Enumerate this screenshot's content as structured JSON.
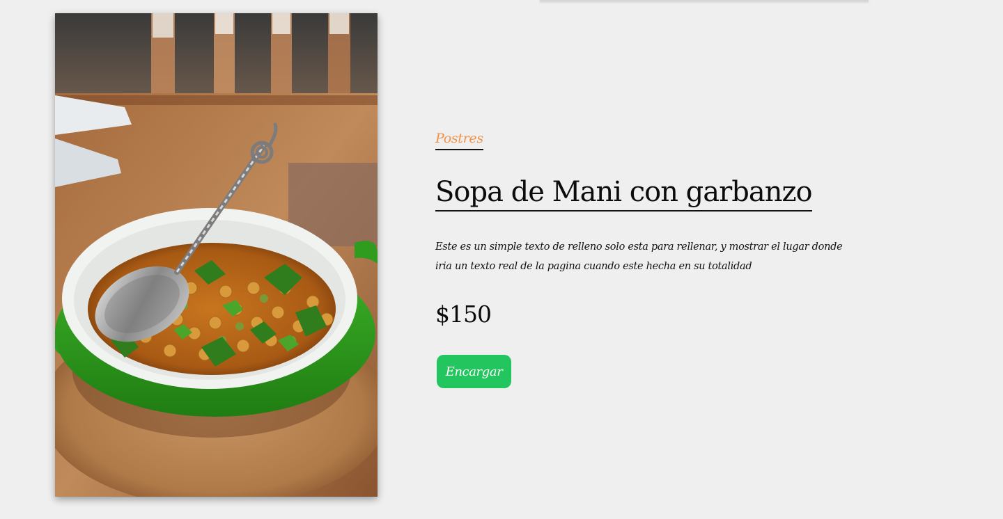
{
  "product": {
    "category": "Postres",
    "title": "Sopa de Mani con garbanzo",
    "description": "Este es un simple texto de relleno solo esta para rellenar, y mostrar el lugar donde iria un texto real de la pagina cuando este hecha en su totalidad",
    "price": "$150",
    "order_label": "Encargar"
  },
  "colors": {
    "background": "#efefef",
    "category": "#f0934a",
    "button": "#22c55e",
    "text": "#0c0c0c"
  }
}
